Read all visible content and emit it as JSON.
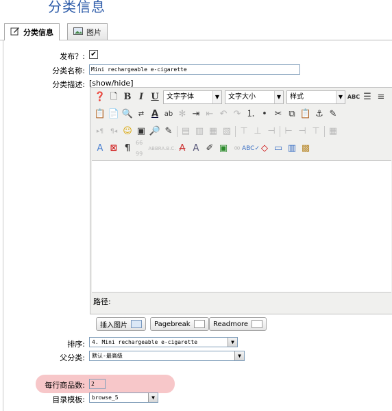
{
  "page": {
    "title": "分类信息"
  },
  "tabs": [
    {
      "label": "分类信息",
      "icon": "edit-icon",
      "active": true
    },
    {
      "label": "图片",
      "icon": "image-icon",
      "active": false
    }
  ],
  "form": {
    "publish": {
      "label": "发布？:",
      "checked": true
    },
    "name": {
      "label": "分类名称:",
      "value": "Mini rechargeable e-cigarette"
    },
    "desc": {
      "label": "分类描述:",
      "toggle": "[show/hide]"
    },
    "order": {
      "label": "排序:",
      "value": "4. Mini rechargeable e-cigarette"
    },
    "parent": {
      "label": "父分类:",
      "value": "默认-最高级"
    },
    "per_row": {
      "label": "每行商品数:",
      "value": "2"
    },
    "template": {
      "label": "目录模板:",
      "value": "browse_5"
    }
  },
  "editor": {
    "font_family": "文字字体",
    "font_size": "文字大小",
    "style": "样式",
    "path_label": "路径:",
    "buttons": {
      "insert_image": "插入图片",
      "pagebreak": "Pagebreak",
      "readmore": "Readmore"
    }
  },
  "colors": {
    "title": "#2b5aa8",
    "highlight": "#f7c7c9"
  }
}
